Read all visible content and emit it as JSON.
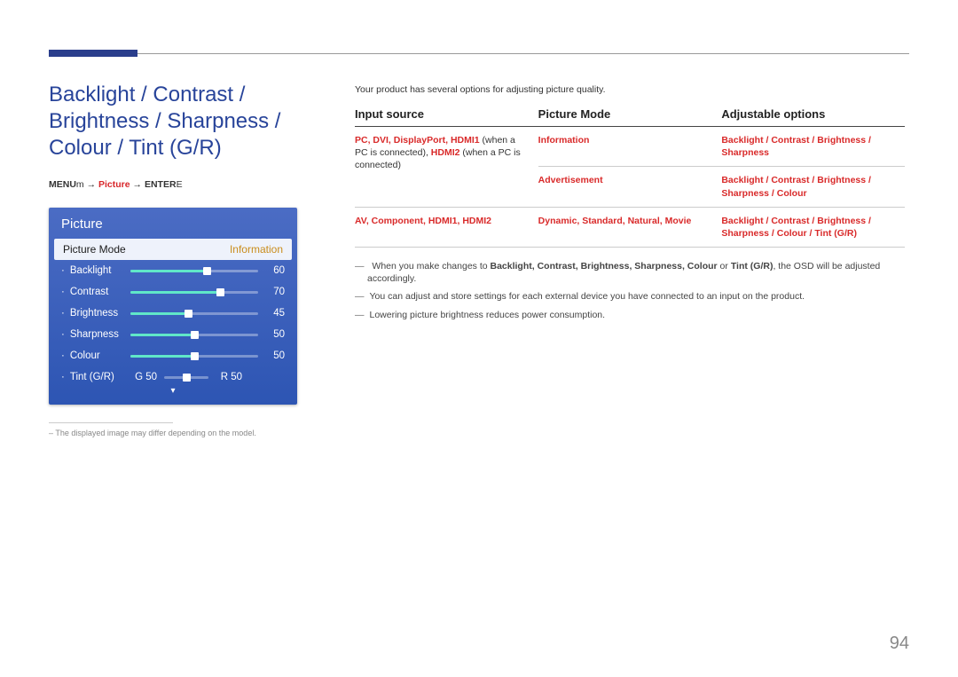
{
  "page_number": "94",
  "title": "Backlight / Contrast / Brightness / Sharpness / Colour / Tint (G/R)",
  "menu_path": {
    "prefix": "MENU",
    "sym1": "m",
    "arrow": " → ",
    "mid": "Picture",
    "suffix": "ENTER",
    "sym2": "E"
  },
  "osd": {
    "title": "Picture",
    "highlight_left": "Picture Mode",
    "highlight_right": "Information",
    "rows": [
      {
        "label": "Backlight",
        "value": "60",
        "pct": 60
      },
      {
        "label": "Contrast",
        "value": "70",
        "pct": 70
      },
      {
        "label": "Brightness",
        "value": "45",
        "pct": 45
      },
      {
        "label": "Sharpness",
        "value": "50",
        "pct": 50
      },
      {
        "label": "Colour",
        "value": "50",
        "pct": 50
      }
    ],
    "tint": {
      "label": "Tint (G/R)",
      "g": "G 50",
      "r": "R 50"
    }
  },
  "footnote": "The displayed image may differ depending on the model.",
  "intro": "Your product has several options for adjusting picture quality.",
  "table": {
    "headers": [
      "Input source",
      "Picture Mode",
      "Adjustable options"
    ],
    "rows": [
      {
        "c1_red": "PC, DVI, DisplayPort, HDMI1",
        "c1_plain": " (when a PC is connected), ",
        "c1_red2": "HDMI2",
        "c1_plain2": " (when a PC is connected)",
        "c2": "Information",
        "c3": "Backlight / Contrast / Brightness / Sharpness"
      },
      {
        "c1_red": "",
        "c1_plain": "",
        "c1_red2": "",
        "c1_plain2": "",
        "c2": "Advertisement",
        "c3": "Backlight / Contrast / Brightness / Sharpness / Colour"
      },
      {
        "c1_red": "AV, Component, HDMI1, HDMI2",
        "c1_plain": "",
        "c1_red2": "",
        "c1_plain2": "",
        "c2": "Dynamic, Standard, Natural, Movie",
        "c3": "Backlight / Contrast / Brightness / Sharpness / Colour / Tint (G/R)"
      }
    ]
  },
  "notes": [
    {
      "pre": "When you make changes to ",
      "bold": "Backlight, Contrast, Brightness, Sharpness, Colour",
      "mid": " or ",
      "bold2": "Tint (G/R)",
      "post": ", the OSD will be adjusted accordingly."
    },
    {
      "text": "You can adjust and store settings for each external device you have connected to an input on the product."
    },
    {
      "text": "Lowering picture brightness reduces power consumption."
    }
  ]
}
